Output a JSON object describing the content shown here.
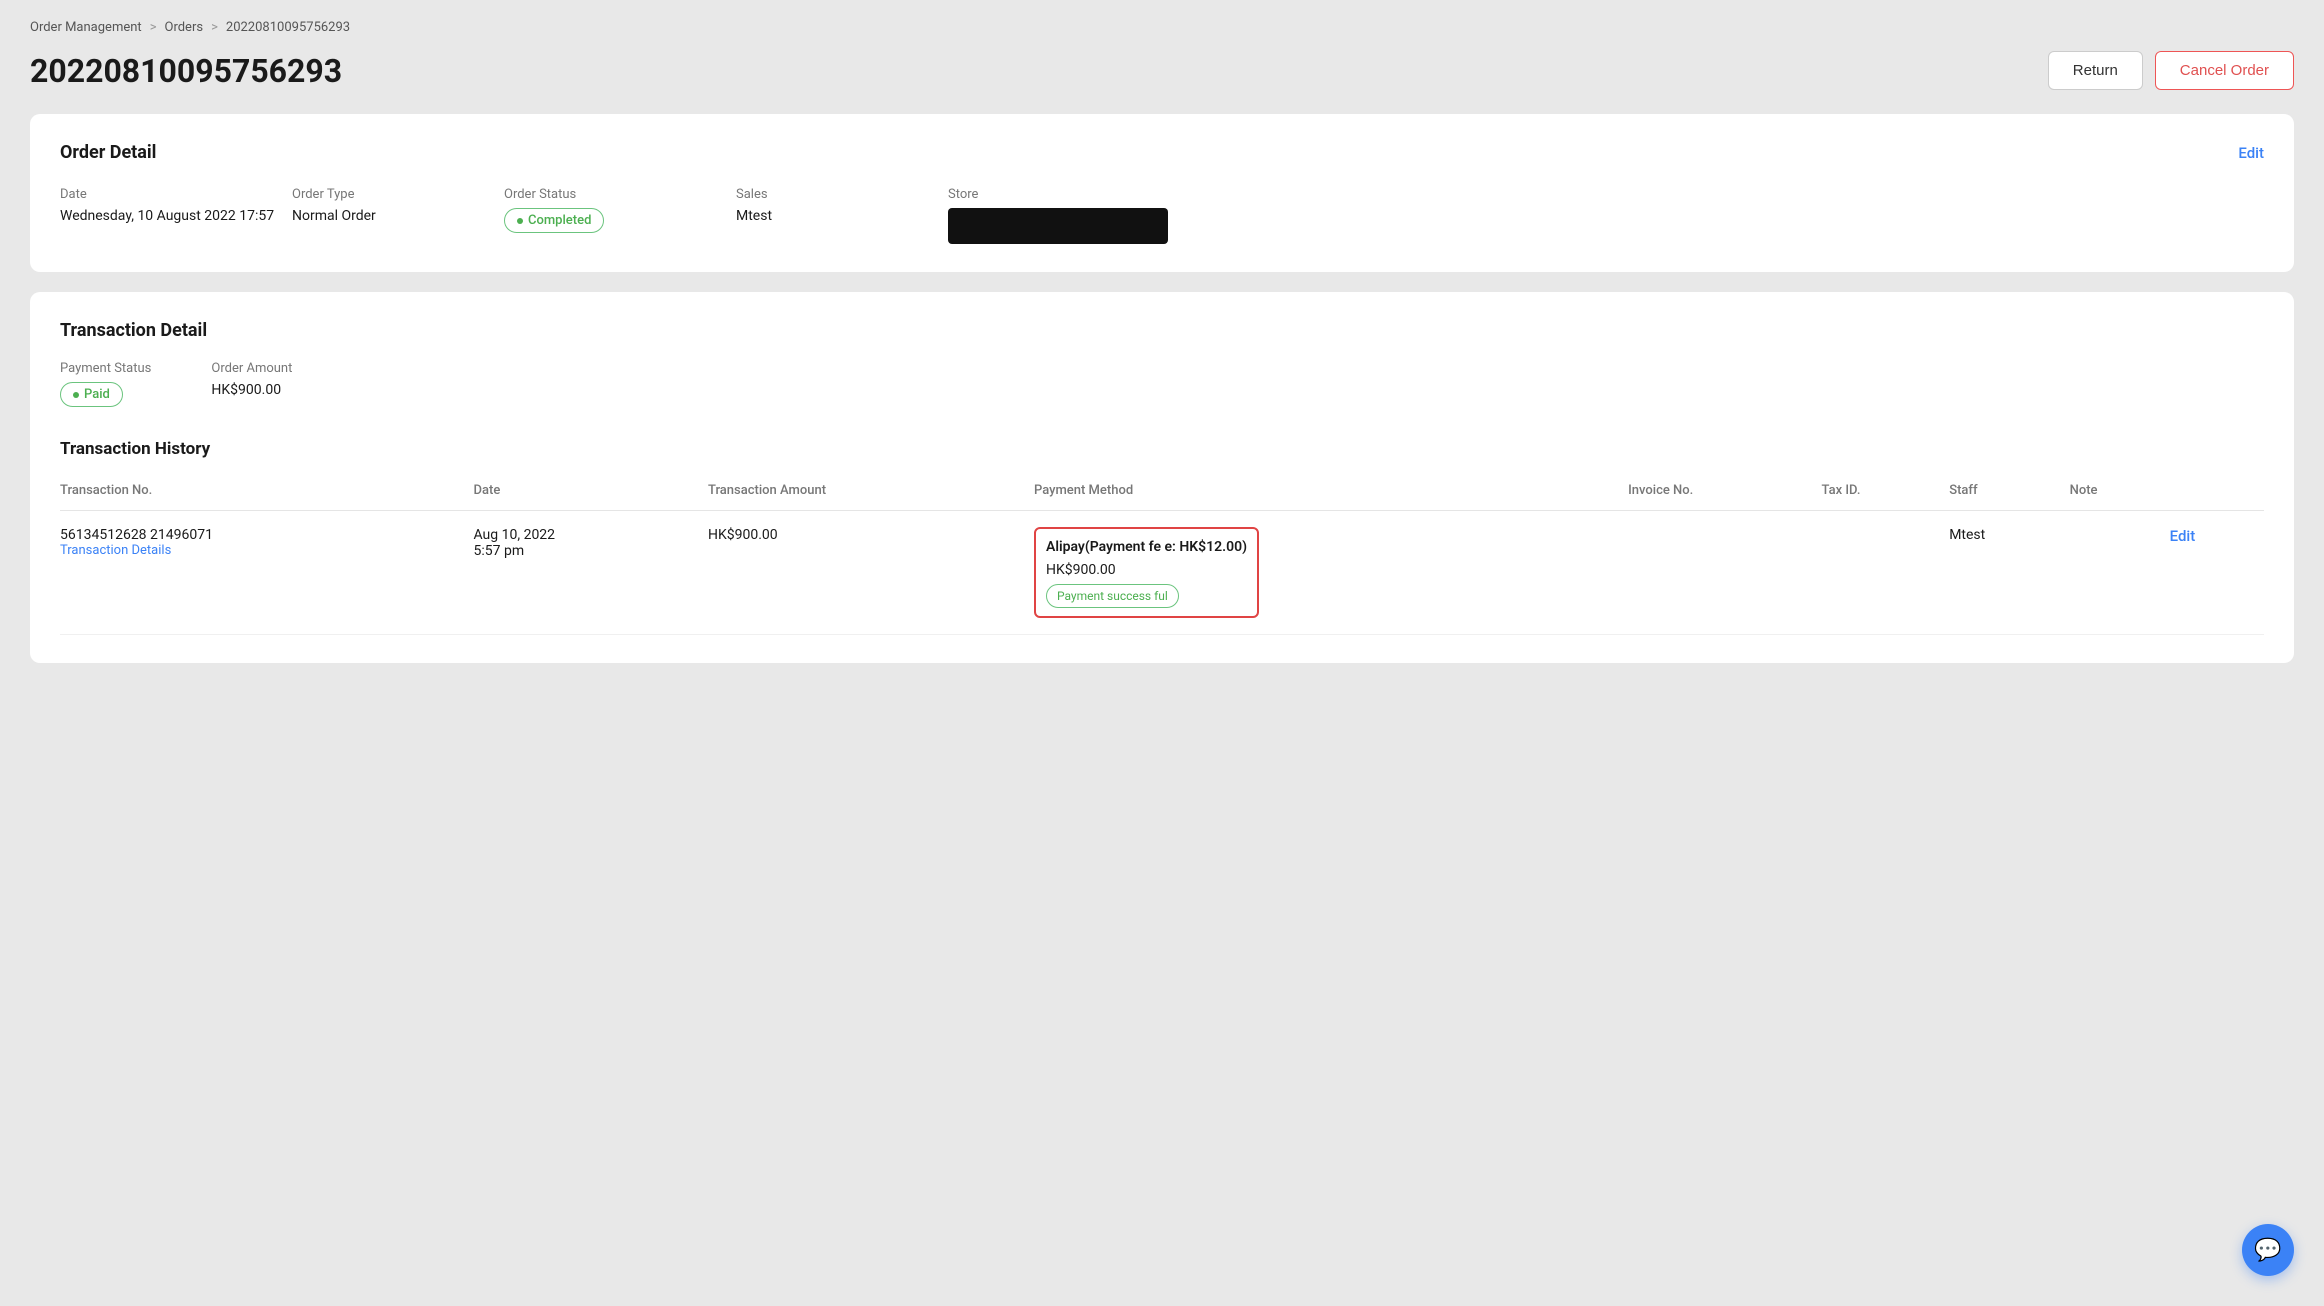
{
  "breadcrumb": {
    "item1": "Order Management",
    "item2": "Orders",
    "item3": "20220810095756293",
    "sep1": ">",
    "sep2": ">"
  },
  "page": {
    "title": "20220810095756293",
    "return_label": "Return",
    "cancel_label": "Cancel Order"
  },
  "order_detail": {
    "section_title": "Order Detail",
    "edit_label": "Edit",
    "date_label": "Date",
    "date_value": "Wednesday, 10 August 2022 17:57",
    "order_type_label": "Order Type",
    "order_type_value": "Normal Order",
    "order_status_label": "Order Status",
    "order_status_value": "Completed",
    "sales_label": "Sales",
    "sales_value": "Mtest",
    "store_label": "Store"
  },
  "transaction_detail": {
    "section_title": "Transaction Detail",
    "payment_status_label": "Payment Status",
    "payment_status_value": "Paid",
    "order_amount_label": "Order Amount",
    "order_amount_value": "HK$900.00",
    "history_title": "Transaction History",
    "table_headers": {
      "transaction_no": "Transaction No.",
      "date": "Date",
      "amount": "Transaction Amount",
      "payment_method": "Payment Method",
      "invoice_no": "Invoice No.",
      "tax_id": "Tax ID.",
      "staff": "Staff",
      "note": "Note"
    },
    "row": {
      "transaction_no": "56134512628 21496071",
      "transaction_details_link": "Transaction Details",
      "date": "Aug 10, 2022",
      "time": "5:57 pm",
      "amount": "HK$900.00",
      "payment_method_name": "Alipay(Payment fe e: HK$12.00)",
      "payment_amount": "HK$900.00",
      "payment_status": "Payment success ful",
      "staff": "Mtest",
      "edit_link": "Edit"
    }
  },
  "icons": {
    "chat": "💬"
  }
}
